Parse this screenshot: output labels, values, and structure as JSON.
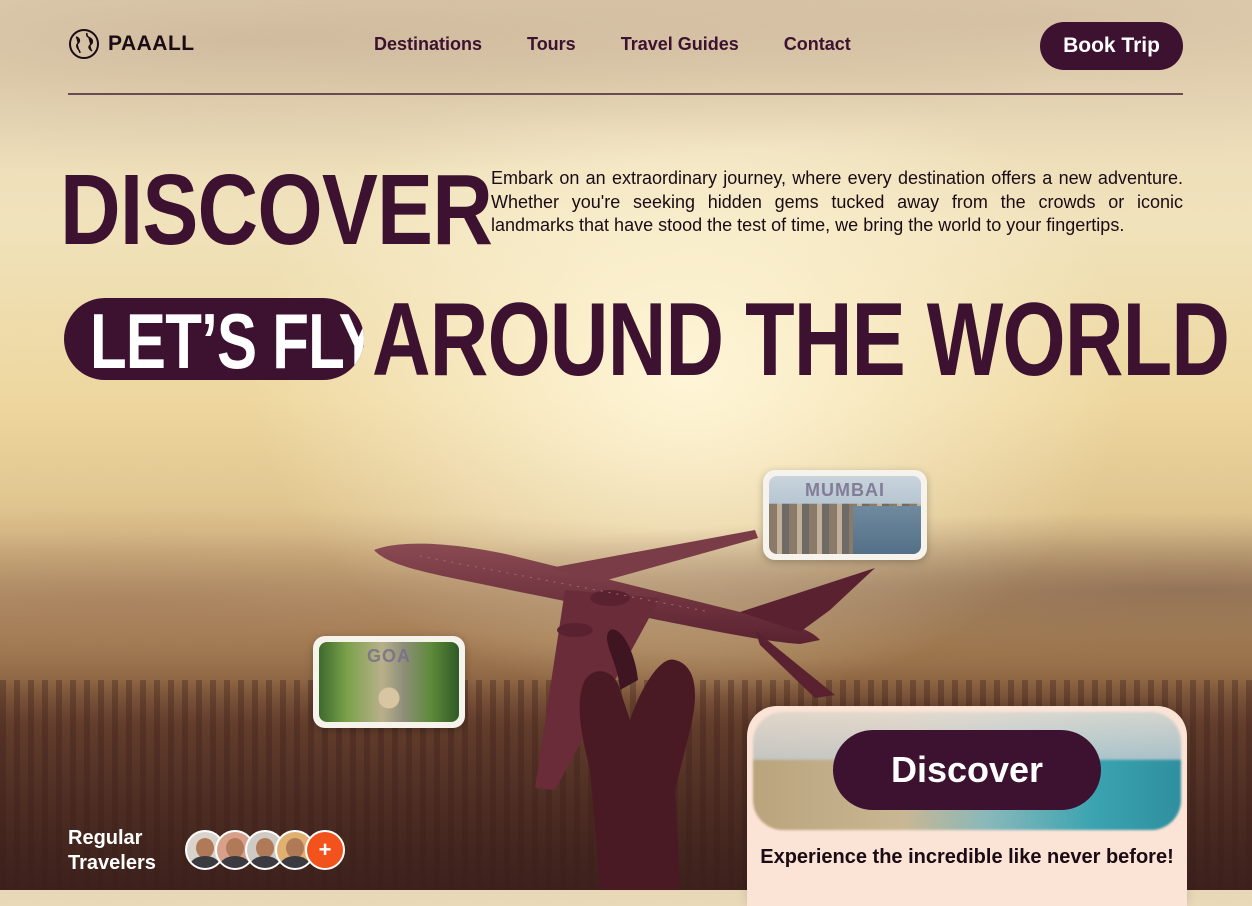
{
  "brand": {
    "name": "PAAALL",
    "icon": "globe-icon"
  },
  "nav": {
    "items": [
      {
        "label": "Destinations"
      },
      {
        "label": "Tours"
      },
      {
        "label": "Travel Guides"
      },
      {
        "label": "Contact"
      }
    ],
    "cta_label": "Book Trip"
  },
  "hero": {
    "headline_1": "DISCOVER",
    "pill_text": "LET’S FLY",
    "headline_2": "AROUND THE WORLD",
    "intro": "Embark on an extraordinary journey, where every destination offers a new adventure. Whether you're seeking hidden gems tucked away from the crowds or iconic landmarks that have stood the test of time, we bring the world to your fingertips."
  },
  "cards": {
    "mumbai": "MUMBAI",
    "goa": "GOA"
  },
  "discover_panel": {
    "button_label": "Discover",
    "tagline": "Experience the incredible like never before!"
  },
  "travelers": {
    "label": "Regular Travelers",
    "more_symbol": "+"
  },
  "colors": {
    "brand": "#3d1130",
    "accent_orange": "#f2531c",
    "panel_bg": "#fbe3d6"
  }
}
